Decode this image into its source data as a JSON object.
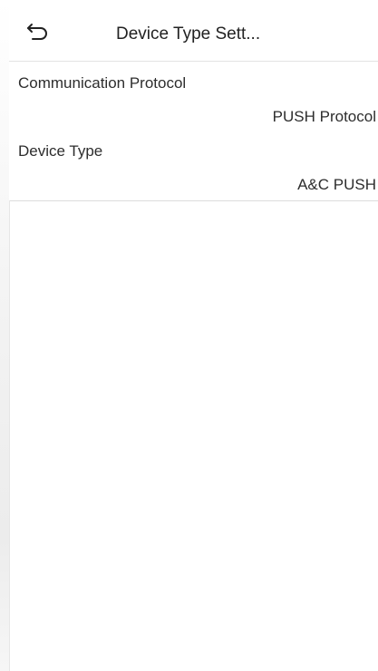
{
  "header": {
    "title": "Device Type Sett...",
    "back_icon": "back-arrow-icon"
  },
  "settings": [
    {
      "label": "Communication Protocol",
      "value": "PUSH Protocol"
    },
    {
      "label": "Device Type",
      "value": "A&C PUSH"
    }
  ],
  "colors": {
    "background": "#ffffff",
    "text": "#2d2d2d",
    "divider": "#dcdcdc"
  }
}
